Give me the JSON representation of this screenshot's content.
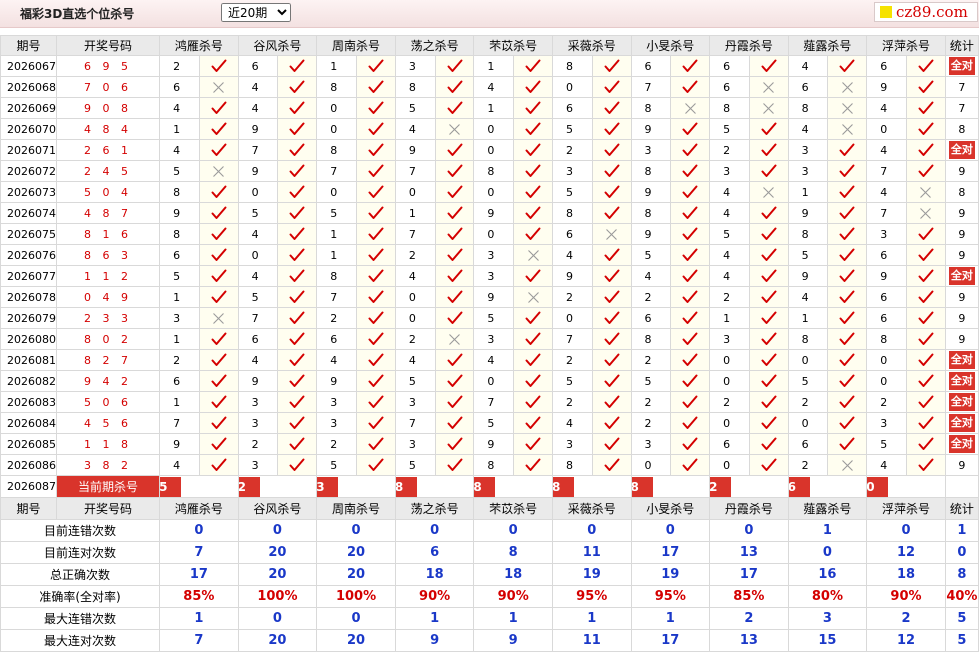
{
  "header": {
    "title": "福彩3D直选个位杀号",
    "period_selected": "近20期",
    "period_options": [
      "近20期"
    ],
    "logo_text": "cz89.com"
  },
  "columns": {
    "issue": "期号",
    "code": "开奖号码",
    "experts": [
      "鸿雁杀号",
      "谷风杀号",
      "周南杀号",
      "荡之杀号",
      "芣苡杀号",
      "采薇杀号",
      "小旻杀号",
      "丹霞杀号",
      "薤露杀号",
      "浮萍杀号"
    ],
    "stat": "统计"
  },
  "rows": [
    {
      "issue": "2026067",
      "code": "6 9 5",
      "nums": [
        "2",
        "6",
        "1",
        "3",
        "1",
        "8",
        "6",
        "6",
        "4",
        "6"
      ],
      "marks": [
        1,
        1,
        1,
        1,
        1,
        1,
        1,
        1,
        1,
        1
      ],
      "stat": "全对"
    },
    {
      "issue": "2026068",
      "code": "7 0 6",
      "nums": [
        "6",
        "4",
        "8",
        "8",
        "4",
        "0",
        "7",
        "6",
        "6",
        "9"
      ],
      "marks": [
        0,
        1,
        1,
        1,
        1,
        1,
        1,
        0,
        0,
        1
      ],
      "stat": "7"
    },
    {
      "issue": "2026069",
      "code": "9 0 8",
      "nums": [
        "4",
        "4",
        "0",
        "5",
        "1",
        "6",
        "8",
        "8",
        "8",
        "4"
      ],
      "marks": [
        1,
        1,
        1,
        1,
        1,
        1,
        0,
        0,
        0,
        1
      ],
      "stat": "7"
    },
    {
      "issue": "2026070",
      "code": "4 8 4",
      "nums": [
        "1",
        "9",
        "0",
        "4",
        "0",
        "5",
        "9",
        "5",
        "4",
        "0"
      ],
      "marks": [
        1,
        1,
        1,
        0,
        1,
        1,
        1,
        1,
        0,
        1
      ],
      "stat": "8"
    },
    {
      "issue": "2026071",
      "code": "2 6 1",
      "nums": [
        "4",
        "7",
        "8",
        "9",
        "0",
        "2",
        "3",
        "2",
        "3",
        "4"
      ],
      "marks": [
        1,
        1,
        1,
        1,
        1,
        1,
        1,
        1,
        1,
        1
      ],
      "stat": "全对"
    },
    {
      "issue": "2026072",
      "code": "2 4 5",
      "nums": [
        "5",
        "9",
        "7",
        "7",
        "8",
        "3",
        "8",
        "3",
        "3",
        "7"
      ],
      "marks": [
        0,
        1,
        1,
        1,
        1,
        1,
        1,
        1,
        1,
        1
      ],
      "stat": "9"
    },
    {
      "issue": "2026073",
      "code": "5 0 4",
      "nums": [
        "8",
        "0",
        "0",
        "0",
        "0",
        "5",
        "9",
        "4",
        "1",
        "4"
      ],
      "marks": [
        1,
        1,
        1,
        1,
        1,
        1,
        1,
        0,
        1,
        0
      ],
      "stat": "8"
    },
    {
      "issue": "2026074",
      "code": "4 8 7",
      "nums": [
        "9",
        "5",
        "5",
        "1",
        "9",
        "8",
        "8",
        "4",
        "9",
        "7"
      ],
      "marks": [
        1,
        1,
        1,
        1,
        1,
        1,
        1,
        1,
        1,
        0
      ],
      "stat": "9"
    },
    {
      "issue": "2026075",
      "code": "8 1 6",
      "nums": [
        "8",
        "4",
        "1",
        "7",
        "0",
        "6",
        "9",
        "5",
        "8",
        "3"
      ],
      "marks": [
        1,
        1,
        1,
        1,
        1,
        0,
        1,
        1,
        1,
        1
      ],
      "stat": "9"
    },
    {
      "issue": "2026076",
      "code": "8 6 3",
      "nums": [
        "6",
        "0",
        "1",
        "2",
        "3",
        "4",
        "5",
        "4",
        "5",
        "6"
      ],
      "marks": [
        1,
        1,
        1,
        1,
        0,
        1,
        1,
        1,
        1,
        1
      ],
      "stat": "9"
    },
    {
      "issue": "2026077",
      "code": "1 1 2",
      "nums": [
        "5",
        "4",
        "8",
        "4",
        "3",
        "9",
        "4",
        "4",
        "9",
        "9"
      ],
      "marks": [
        1,
        1,
        1,
        1,
        1,
        1,
        1,
        1,
        1,
        1
      ],
      "stat": "全对"
    },
    {
      "issue": "2026078",
      "code": "0 4 9",
      "nums": [
        "1",
        "5",
        "7",
        "0",
        "9",
        "2",
        "2",
        "2",
        "4",
        "6"
      ],
      "marks": [
        1,
        1,
        1,
        1,
        0,
        1,
        1,
        1,
        1,
        1
      ],
      "stat": "9"
    },
    {
      "issue": "2026079",
      "code": "2 3 3",
      "nums": [
        "3",
        "7",
        "2",
        "0",
        "5",
        "0",
        "6",
        "1",
        "1",
        "6"
      ],
      "marks": [
        0,
        1,
        1,
        1,
        1,
        1,
        1,
        1,
        1,
        1
      ],
      "stat": "9"
    },
    {
      "issue": "2026080",
      "code": "8 0 2",
      "nums": [
        "1",
        "6",
        "6",
        "2",
        "3",
        "7",
        "8",
        "3",
        "8",
        "8"
      ],
      "marks": [
        1,
        1,
        1,
        0,
        1,
        1,
        1,
        1,
        1,
        1
      ],
      "stat": "9"
    },
    {
      "issue": "2026081",
      "code": "8 2 7",
      "nums": [
        "2",
        "4",
        "4",
        "4",
        "4",
        "2",
        "2",
        "0",
        "0",
        "0"
      ],
      "marks": [
        1,
        1,
        1,
        1,
        1,
        1,
        1,
        1,
        1,
        1
      ],
      "stat": "全对"
    },
    {
      "issue": "2026082",
      "code": "9 4 2",
      "nums": [
        "6",
        "9",
        "9",
        "5",
        "0",
        "5",
        "5",
        "0",
        "5",
        "0"
      ],
      "marks": [
        1,
        1,
        1,
        1,
        1,
        1,
        1,
        1,
        1,
        1
      ],
      "stat": "全对"
    },
    {
      "issue": "2026083",
      "code": "5 0 6",
      "nums": [
        "1",
        "3",
        "3",
        "3",
        "7",
        "2",
        "2",
        "2",
        "2",
        "2"
      ],
      "marks": [
        1,
        1,
        1,
        1,
        1,
        1,
        1,
        1,
        1,
        1
      ],
      "stat": "全对"
    },
    {
      "issue": "2026084",
      "code": "4 5 6",
      "nums": [
        "7",
        "3",
        "3",
        "7",
        "5",
        "4",
        "2",
        "0",
        "0",
        "3"
      ],
      "marks": [
        1,
        1,
        1,
        1,
        1,
        1,
        1,
        1,
        1,
        1
      ],
      "stat": "全对"
    },
    {
      "issue": "2026085",
      "code": "1 1 8",
      "nums": [
        "9",
        "2",
        "2",
        "3",
        "9",
        "3",
        "3",
        "6",
        "6",
        "5"
      ],
      "marks": [
        1,
        1,
        1,
        1,
        1,
        1,
        1,
        1,
        1,
        1
      ],
      "stat": "全对"
    },
    {
      "issue": "2026086",
      "code": "3 8 2",
      "nums": [
        "4",
        "3",
        "5",
        "5",
        "8",
        "8",
        "0",
        "0",
        "2",
        "4"
      ],
      "marks": [
        1,
        1,
        1,
        1,
        1,
        1,
        1,
        1,
        0,
        1
      ],
      "stat": "9"
    }
  ],
  "current": {
    "issue": "2026087",
    "label": "当前期杀号",
    "nums": [
      "5",
      "2",
      "3",
      "8",
      "8",
      "8",
      "8",
      "2",
      "6",
      "0"
    ]
  },
  "summary": {
    "header_issue": "期号",
    "header_code": "开奖号码",
    "rows": [
      {
        "label": "目前连错次数",
        "values": [
          "0",
          "0",
          "0",
          "0",
          "0",
          "0",
          "0",
          "0",
          "1",
          "0"
        ],
        "stat": "1",
        "red": false
      },
      {
        "label": "目前连对次数",
        "values": [
          "7",
          "20",
          "20",
          "6",
          "8",
          "11",
          "17",
          "13",
          "0",
          "12"
        ],
        "stat": "0",
        "red": false
      },
      {
        "label": "总正确次数",
        "values": [
          "17",
          "20",
          "20",
          "18",
          "18",
          "19",
          "19",
          "17",
          "16",
          "18"
        ],
        "stat": "8",
        "red": false
      },
      {
        "label": "准确率(全对率)",
        "values": [
          "85%",
          "100%",
          "100%",
          "90%",
          "90%",
          "95%",
          "95%",
          "85%",
          "80%",
          "90%"
        ],
        "stat": "40%",
        "red": true
      },
      {
        "label": "最大连错次数",
        "values": [
          "1",
          "0",
          "0",
          "1",
          "1",
          "1",
          "1",
          "2",
          "3",
          "2"
        ],
        "stat": "5",
        "red": false
      },
      {
        "label": "最大连对次数",
        "values": [
          "7",
          "20",
          "20",
          "9",
          "9",
          "11",
          "17",
          "13",
          "15",
          "12"
        ],
        "stat": "5",
        "red": false
      }
    ]
  },
  "icons": {
    "right": "check-icon",
    "wrong": "cross-icon"
  },
  "colors": {
    "accent": "#d9342b",
    "value_blue": "#1a38c8",
    "check_red": "#d40000",
    "cross_gray": "#9a9a9a"
  }
}
